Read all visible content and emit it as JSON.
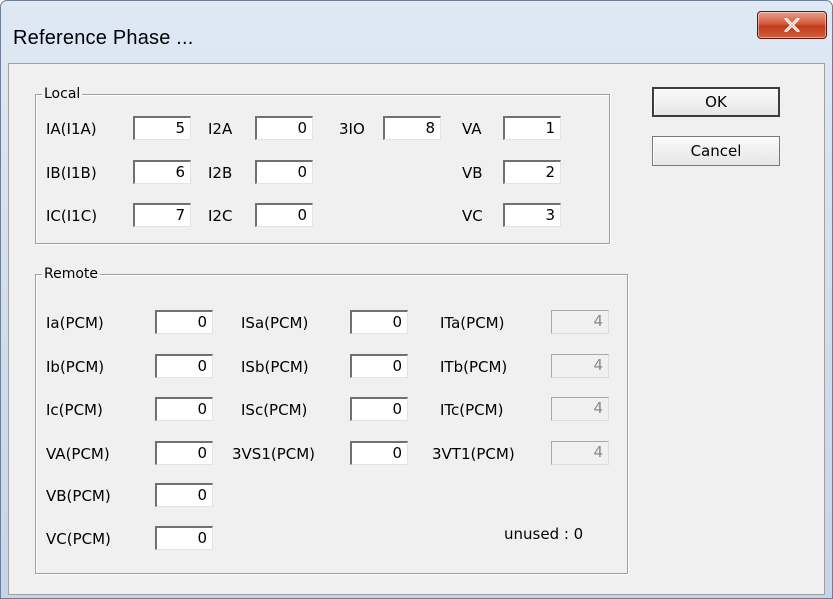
{
  "window": {
    "title": "Reference Phase ...",
    "close_glyph": "x"
  },
  "buttons": {
    "ok": "OK",
    "cancel": "Cancel"
  },
  "local": {
    "title": "Local",
    "fields": {
      "ia_label": "IA(I1A)",
      "ia_value": "5",
      "ib_label": "IB(I1B)",
      "ib_value": "6",
      "ic_label": "IC(I1C)",
      "ic_value": "7",
      "i2a_label": "I2A",
      "i2a_value": "0",
      "i2b_label": "I2B",
      "i2b_value": "0",
      "i2c_label": "I2C",
      "i2c_value": "0",
      "3io_label": "3IO",
      "3io_value": "8",
      "va_label": "VA",
      "va_value": "1",
      "vb_label": "VB",
      "vb_value": "2",
      "vc_label": "VC",
      "vc_value": "3"
    }
  },
  "remote": {
    "title": "Remote",
    "fields": {
      "ia_label": "Ia(PCM)",
      "ia_value": "0",
      "ib_label": "Ib(PCM)",
      "ib_value": "0",
      "ic_label": "Ic(PCM)",
      "ic_value": "0",
      "va_label": "VA(PCM)",
      "va_value": "0",
      "vb_label": "VB(PCM)",
      "vb_value": "0",
      "vc_label": "VC(PCM)",
      "vc_value": "0",
      "isa_label": "ISa(PCM)",
      "isa_value": "0",
      "isb_label": "ISb(PCM)",
      "isb_value": "0",
      "isc_label": "ISc(PCM)",
      "isc_value": "0",
      "3vs1_label": "3VS1(PCM)",
      "3vs1_value": "0",
      "ita_label": "ITa(PCM)",
      "ita_value": "4",
      "itb_label": "ITb(PCM)",
      "itb_value": "4",
      "itc_label": "ITc(PCM)",
      "itc_value": "4",
      "3vt1_label": "3VT1(PCM)",
      "3vt1_value": "4"
    },
    "unused_text": "unused : 0"
  }
}
